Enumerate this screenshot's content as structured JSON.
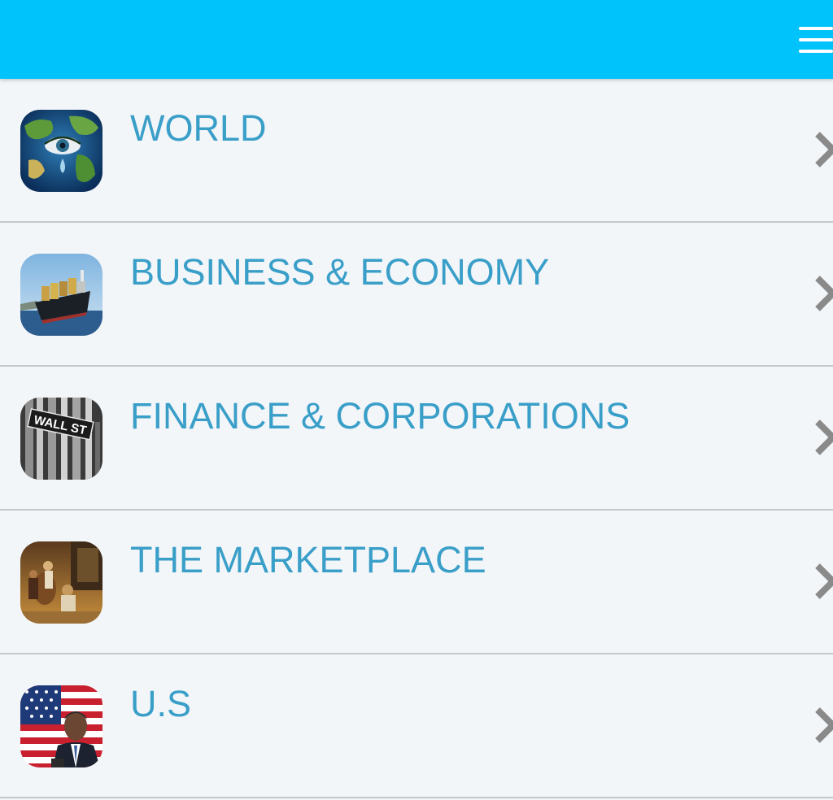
{
  "header": {
    "menu_icon": "hamburger-menu-icon",
    "background_color": "#00c3fc"
  },
  "categories": [
    {
      "label": "WORLD",
      "icon": "earth-eye-tear-image",
      "chevron": "chevron-right-icon"
    },
    {
      "label": "BUSINESS & ECONOMY",
      "icon": "cargo-ship-image",
      "chevron": "chevron-right-icon"
    },
    {
      "label": "FINANCE & CORPORATIONS",
      "icon": "wall-street-sign-image",
      "chevron": "chevron-right-icon",
      "sign_text": "WALL ST"
    },
    {
      "label": "THE MARKETPLACE",
      "icon": "marketplace-painting-image",
      "chevron": "chevron-right-icon"
    },
    {
      "label": "U.S",
      "icon": "us-flag-president-image",
      "chevron": "chevron-right-icon"
    }
  ],
  "colors": {
    "label_text": "#3a9fc8",
    "chevron": "#8a8a8a",
    "divider": "#c4c8cc",
    "background": "#f3f6f9"
  }
}
